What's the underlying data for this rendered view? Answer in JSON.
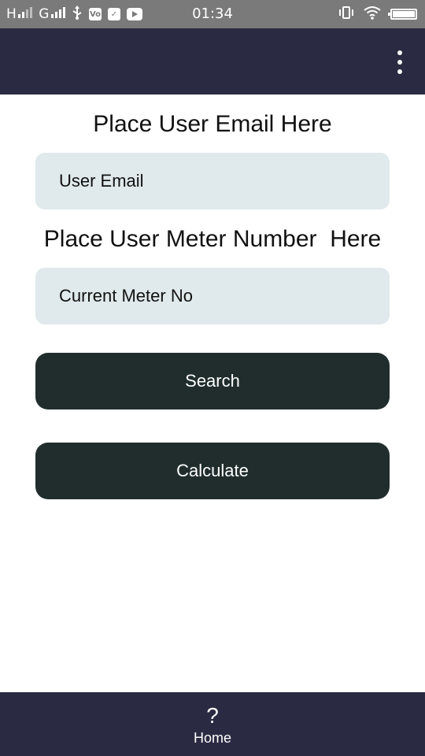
{
  "status_bar": {
    "signal_1": "H",
    "signal_2": "G",
    "time": "01:34",
    "icons": [
      "usb-icon",
      "volte-icon",
      "check-icon",
      "youtube-icon",
      "vibrate-icon",
      "wifi-icon",
      "battery-icon"
    ]
  },
  "app_bar": {
    "menu_icon": "more-vert-icon"
  },
  "form": {
    "email_label": "Place User Email Here",
    "email_placeholder": "User Email",
    "meter_label": "Place User Meter Number  Here",
    "meter_placeholder": "Current Meter No",
    "search_label": "Search",
    "calculate_label": "Calculate"
  },
  "bottom_nav": {
    "home_icon": "?",
    "home_label": "Home"
  },
  "colors": {
    "app_bar": "#2a2a42",
    "field_bg": "#e0e9eb",
    "button_bg": "#212d2d",
    "status_bar": "#7a7a7a"
  }
}
